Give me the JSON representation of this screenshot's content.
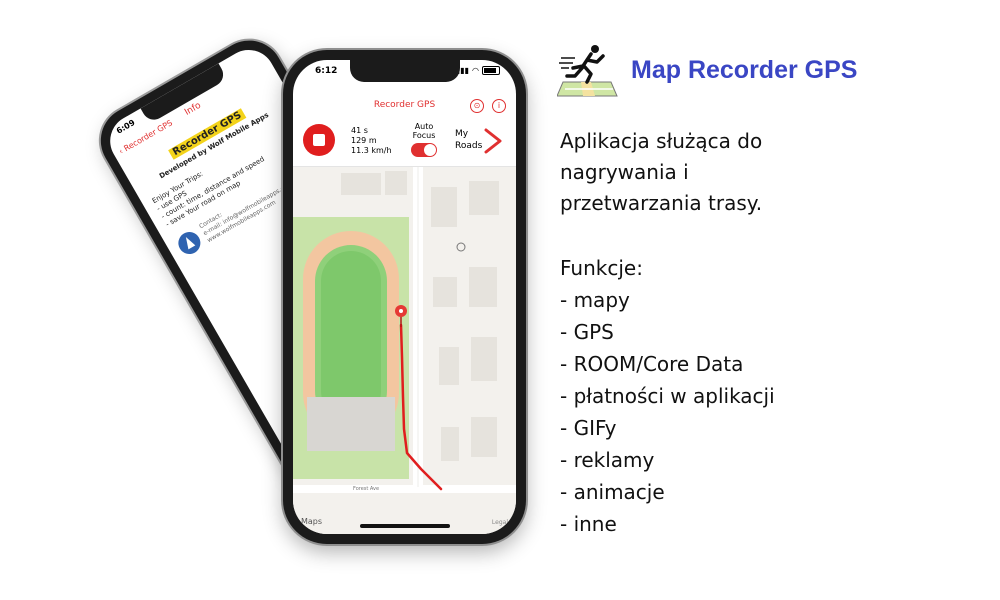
{
  "back_phone": {
    "status_time": "6:09",
    "back_label": "Recorder GPS",
    "title": "Info",
    "app_name": "Recorder GPS",
    "developer": "Developed by Wolf Mobile Apps",
    "body_lines": [
      "Enjoy Your Trips:",
      "- use GPS",
      "- count: time, distance and speed",
      "- save Your road on map"
    ],
    "contact_lines": [
      "Contact:",
      "e-mail: info@wolfmobileapps.com",
      "www.wolfmobileapps.com"
    ]
  },
  "front_phone": {
    "status_time": "6:12",
    "nav_title": "Recorder GPS",
    "stats": {
      "time": "41 s",
      "distance": "129 m",
      "speed": "11.3 km/h"
    },
    "autofocus_label": [
      "Auto",
      "Focus"
    ],
    "autofocus_on": true,
    "my_roads_label": [
      "My",
      "Roads"
    ],
    "map": {
      "street_label": "Forest Ave",
      "maps_brand": "Maps",
      "legal": "Legal"
    },
    "accent": "#e03030"
  },
  "app": {
    "title": "Map Recorder GPS",
    "title_color": "#3a46c4",
    "description_lines": [
      "Aplikacja służąca do",
      "nagrywania i",
      "przetwarzania trasy."
    ],
    "features_heading": "Funkcje:",
    "features": [
      "- mapy",
      "- GPS",
      "- ROOM/Core Data",
      "- płatności w aplikacji",
      "- GIFy",
      "- reklamy",
      "- animacje",
      "- inne"
    ]
  }
}
